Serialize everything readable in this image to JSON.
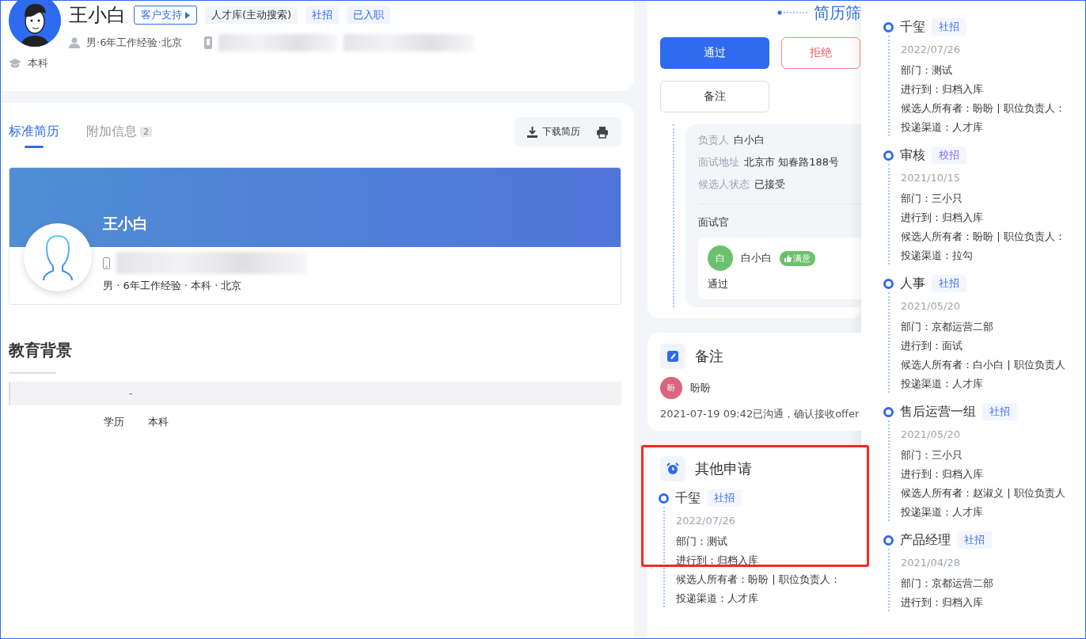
{
  "candidate": {
    "name": "王小白",
    "tags": [
      {
        "label": "客户支持",
        "kind": "dropdown"
      },
      {
        "label": "人才库(主动搜索)",
        "kind": "plain"
      },
      {
        "label": "社招",
        "kind": "blue"
      },
      {
        "label": "已入职",
        "kind": "blue"
      }
    ],
    "info": "男·6年工作经验·北京",
    "education": "本科"
  },
  "resume_tabs": [
    {
      "label": "标准简历",
      "selected": true
    },
    {
      "label": "附加信息",
      "badge": "2",
      "selected": false
    }
  ],
  "download_button": "下载简历",
  "resume_card": {
    "name": "王小白",
    "summary": "男 · 6年工作经验 · 本科 · 北京"
  },
  "education": {
    "title": "教育背景",
    "row_header": "-",
    "rows": [
      {
        "label": "学历",
        "value": "本科"
      }
    ]
  },
  "screening": {
    "title": "简历筛",
    "actions": [
      {
        "label": "通过",
        "kind": "primary"
      },
      {
        "label": "拒绝",
        "kind": "danger"
      },
      {
        "label": "备注",
        "kind": "default"
      }
    ],
    "details": [
      {
        "label": "负责人",
        "value": "白小白"
      },
      {
        "label": "面试地址",
        "value": "北京市 知春路188号"
      },
      {
        "label": "候选人状态",
        "value": "已接受"
      }
    ],
    "interviewers_title": "面试官",
    "interviewer": {
      "avatar": "白",
      "name": "白小白",
      "rating": "满意",
      "result": "通过"
    }
  },
  "notes": {
    "title": "备注",
    "author_avatar": "盼",
    "author": "盼盼",
    "text": "2021-07-19 09:42已沟通，确认接收offer"
  },
  "other_applications": {
    "title": "其他申请",
    "highlighted": true,
    "items": [
      {
        "title": "千玺",
        "tag": "社招",
        "color": "#3a6ff5",
        "date": "2022/07/26",
        "lines": [
          "部门：测试",
          "进行到：归档入库",
          "候选人所有者：盼盼 | 职位负责人：",
          "投递渠道：人才库"
        ]
      }
    ]
  },
  "applications_panel": {
    "items": [
      {
        "title": "千玺",
        "tag": "社招",
        "color": "#3a6ff5",
        "date": "2022/07/26",
        "lines": [
          "部门：测试",
          "进行到：归档入库",
          "候选人所有者：盼盼 | 职位负责人：",
          "投递渠道：人才库"
        ]
      },
      {
        "title": "审核",
        "tag": "校招",
        "color": "#8b6ff0",
        "date": "2021/10/15",
        "lines": [
          "部门：三小只",
          "进行到：归档入库",
          "候选人所有者：盼盼 | 职位负责人：",
          "投递渠道：拉勾"
        ]
      },
      {
        "title": "人事",
        "tag": "社招",
        "color": "#3a6ff5",
        "date": "2021/05/20",
        "lines": [
          "部门：京都运营二部",
          "进行到：面试",
          "候选人所有者：白小白 | 职位负责人",
          "投递渠道：人才库"
        ]
      },
      {
        "title": "售后运营一组",
        "tag": "社招",
        "color": "#3a6ff5",
        "date": "2021/05/20",
        "lines": [
          "部门：三小只",
          "进行到：归档入库",
          "候选人所有者：赵淑义 | 职位负责人",
          "投递渠道：人才库"
        ]
      },
      {
        "title": "产品经理",
        "tag": "社招",
        "color": "#3a6ff5",
        "date": "2021/04/28",
        "lines": [
          "部门：京都运营二部",
          "进行到：归档入库"
        ]
      }
    ]
  }
}
